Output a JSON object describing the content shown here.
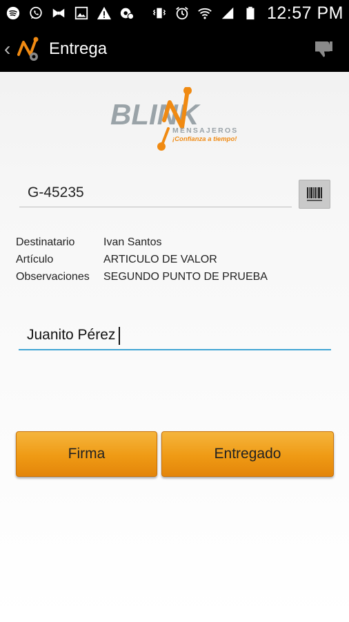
{
  "status_bar": {
    "time": "12:57 PM",
    "left_icons": [
      "spotify-icon",
      "whatsapp-icon",
      "bowtie-icon",
      "image-icon",
      "warning-icon",
      "settings-notification-icon"
    ],
    "right_icons": [
      "vibrate-icon",
      "alarm-icon",
      "wifi-icon",
      "signal-icon",
      "battery-icon"
    ]
  },
  "app_bar": {
    "title": "Entrega",
    "back_glyph": "‹",
    "action_icon": "thumbs-down-icon"
  },
  "brand": {
    "name": "BLINK",
    "subtitle": "MENSAJEROS",
    "slogan": "¡Confianza a tiempo!",
    "primary_color": "#9aa3a8",
    "accent_color": "#f08a12"
  },
  "code_field": {
    "value": "G-45235",
    "scan_button_icon": "barcode-icon"
  },
  "details": [
    {
      "label": "Destinatario",
      "value": "Ivan Santos"
    },
    {
      "label": "Artículo",
      "value": "ARTICULO DE VALOR"
    },
    {
      "label": "Observaciones",
      "value": "SEGUNDO PUNTO DE PRUEBA"
    }
  ],
  "receiver_field": {
    "value": "Juanito Pérez"
  },
  "buttons": {
    "firma": "Firma",
    "entregado": "Entregado"
  }
}
